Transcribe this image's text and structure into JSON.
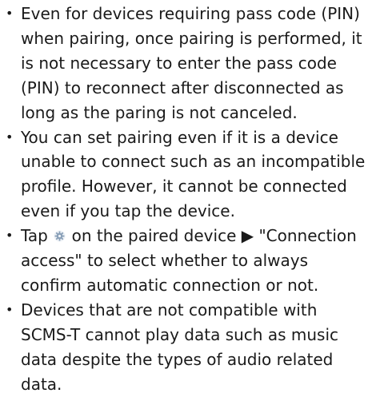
{
  "bullets": [
    {
      "text": "Even for devices requiring pass code (PIN) when pairing, once pairing is performed, it is not necessary to enter the pass code (PIN) to reconnect after disconnected as long as the paring is not canceled."
    },
    {
      "text": "You can set pairing even if it is a device unable to connect such as an incompatible profile. However, it cannot be connected even if you tap the device."
    },
    {
      "text_before_icon": "Tap",
      "icon": "gear-icon",
      "text_after_icon": "on the paired device ▶ \"Connection access\" to select whether to always confirm automatic connection or not."
    },
    {
      "text": "Devices that are not compatible with SCMS-T cannot play data such as music data despite the types of audio related data."
    }
  ],
  "bullet_symbol": "•",
  "colors": {
    "text": "#1a1a1a",
    "icon": "#8aa0b8",
    "background": "#ffffff"
  }
}
